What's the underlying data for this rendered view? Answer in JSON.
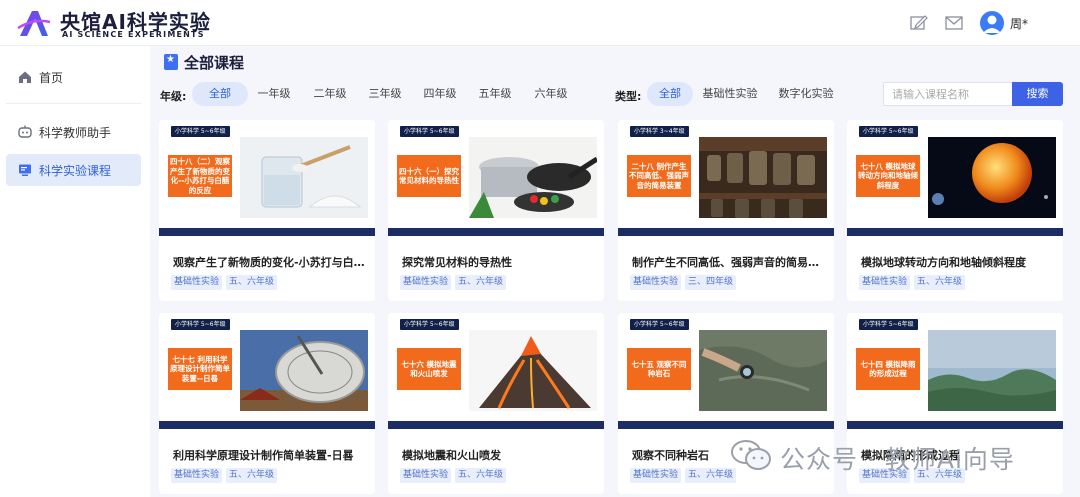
{
  "header": {
    "app_title": "央馆AI科学实验",
    "app_subtitle": "AI SCIENCE EXPERIMENTS",
    "user_name": "周*",
    "colors": {
      "brand": "#6b3ce6",
      "accent": "#3d62e6"
    }
  },
  "sidebar": {
    "items": [
      {
        "label": "首页",
        "icon": "home-icon"
      },
      {
        "label": "科学教师助手",
        "icon": "robot-icon"
      },
      {
        "label": "科学实验课程",
        "icon": "monitor-icon"
      }
    ]
  },
  "main": {
    "title": "全部课程",
    "grade_filter": {
      "label": "年级:",
      "options": [
        "全部",
        "一年级",
        "二年级",
        "三年级",
        "四年级",
        "五年级",
        "六年级"
      ],
      "selected": "全部"
    },
    "type_filter": {
      "label": "类型:",
      "options": [
        "全部",
        "基础性实验",
        "数字化实验"
      ],
      "selected": "全部"
    },
    "search": {
      "placeholder": "请输入课程名称",
      "button": "搜索"
    },
    "cards": [
      {
        "grade_tag": "小学科学 5~6年级",
        "thumb_label": "四十八（二）观察产生了新物质的变化--小苏打与白醋的反应",
        "title": "观察产生了新物质的变化-小苏打与白醋的反应",
        "tags": [
          "基础性实验",
          "五、六年级"
        ]
      },
      {
        "grade_tag": "小学科学 5~6年级",
        "thumb_label": "四十六（一）探究常见材料的导热性",
        "title": "探究常见材料的导热性",
        "tags": [
          "基础性实验",
          "五、六年级"
        ]
      },
      {
        "grade_tag": "小学科学 3~4年级",
        "thumb_label": "二十八 制作产生不同高低、强弱声音的简易装置",
        "title": "制作产生不同高低、强弱声音的简易装置",
        "tags": [
          "基础性实验",
          "三、四年级"
        ]
      },
      {
        "grade_tag": "小学科学 5~6年级",
        "thumb_label": "七十八 模拟地球转动方向和地轴倾斜程度",
        "title": "模拟地球转动方向和地轴倾斜程度",
        "tags": [
          "基础性实验",
          "五、六年级"
        ]
      },
      {
        "grade_tag": "小学科学 5~6年级",
        "thumb_label": "七十七 利用科学原理设计制作简单装置--日晷",
        "title": "利用科学原理设计制作简单装置-日晷",
        "tags": [
          "基础性实验",
          "五、六年级"
        ]
      },
      {
        "grade_tag": "小学科学 5~6年级",
        "thumb_label": "七十六 模拟地震和火山喷发",
        "title": "模拟地震和火山喷发",
        "tags": [
          "基础性实验",
          "五、六年级"
        ]
      },
      {
        "grade_tag": "小学科学 5~6年级",
        "thumb_label": "七十五 观察不同种岩石",
        "title": "观察不同种岩石",
        "tags": [
          "基础性实验",
          "五、六年级"
        ]
      },
      {
        "grade_tag": "小学科学 5~6年级",
        "thumb_label": "七十四 模拟降雨的形成过程",
        "title": "模拟降雨的形成过程",
        "tags": [
          "基础性实验",
          "五、六年级"
        ]
      }
    ]
  },
  "watermark": {
    "text": "公众号 · 教师Ai向导"
  }
}
